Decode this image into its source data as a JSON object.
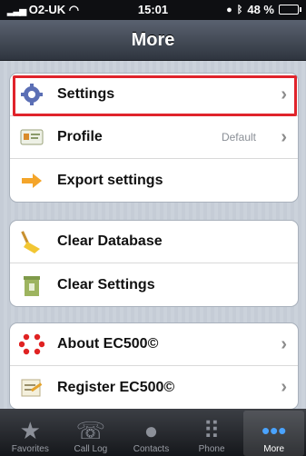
{
  "status": {
    "carrier": "O2-UK",
    "time": "15:01",
    "battery": "48 %"
  },
  "navbar": {
    "title": "More"
  },
  "groups": [
    {
      "rows": [
        {
          "label": "Settings",
          "icon": "gear-icon",
          "detail": "",
          "chevron": true
        },
        {
          "label": "Profile",
          "icon": "profile-card-icon",
          "detail": "Default",
          "chevron": true
        },
        {
          "label": "Export settings",
          "icon": "export-arrow-icon",
          "detail": "",
          "chevron": false
        }
      ]
    },
    {
      "rows": [
        {
          "label": "Clear Database",
          "icon": "broom-icon",
          "detail": ""
        },
        {
          "label": "Clear Settings",
          "icon": "trash-icon",
          "detail": ""
        }
      ]
    },
    {
      "rows": [
        {
          "label": "About EC500©",
          "icon": "dots-logo-icon",
          "detail": "",
          "chevron": true
        },
        {
          "label": "Register EC500©",
          "icon": "register-pen-icon",
          "detail": "",
          "chevron": true
        }
      ]
    }
  ],
  "tabs": [
    {
      "label": "Favorites",
      "icon": "star-icon"
    },
    {
      "label": "Call Log",
      "icon": "call-log-icon"
    },
    {
      "label": "Contacts",
      "icon": "contacts-icon"
    },
    {
      "label": "Phone",
      "icon": "keypad-icon"
    },
    {
      "label": "More",
      "icon": "more-icon",
      "selected": true
    }
  ],
  "colors": {
    "highlight": "#e0232b",
    "selected_tab": "#4aa3ff"
  }
}
